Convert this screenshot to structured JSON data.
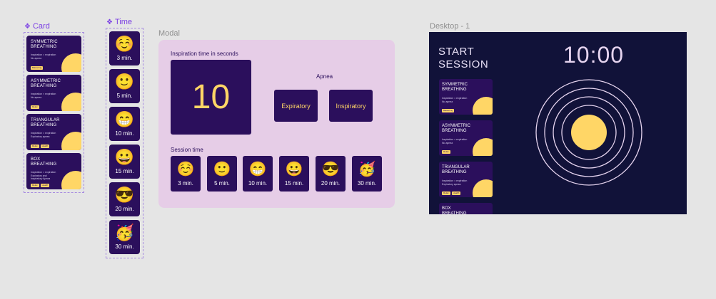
{
  "labels": {
    "card_component": "Card",
    "time_component": "Time",
    "modal_frame": "Modal",
    "desktop_frame": "Desktop - 1",
    "component_icon": "component-diamond-icon"
  },
  "cards": [
    {
      "title_1": "SYMMETRIC",
      "title_2": "BREATHING",
      "desc_1": "Inspiration = expiration",
      "desc_2": "No apnea",
      "tags": [
        "Balancing"
      ]
    },
    {
      "title_1": "ASYMMETRIC",
      "title_2": "BREATHING",
      "desc_1": "Inspiration < expiration",
      "desc_2": "No apnea",
      "tags": [
        "Relax"
      ]
    },
    {
      "title_1": "TRIANGULAR",
      "title_2": "BREATHING",
      "desc_1": "Inspiration = expiration",
      "desc_2": "Expiratory apnea",
      "tags": [
        "Relax",
        "Health"
      ]
    },
    {
      "title_1": "BOX",
      "title_2": "BREATHING",
      "desc_1": "Inspiration = expiration",
      "desc_2": "Expiratory and",
      "desc_3": "Inspiratory Apnea",
      "tags": [
        "Relax",
        "Health"
      ]
    }
  ],
  "times": [
    {
      "emoji": "☺️",
      "label": "3 min."
    },
    {
      "emoji": "🙂",
      "label": "5 min."
    },
    {
      "emoji": "😁",
      "label": "10 min."
    },
    {
      "emoji": "😀",
      "label": "15 min."
    },
    {
      "emoji": "😎",
      "label": "20 min."
    },
    {
      "emoji": "🥳",
      "label": "30 min."
    }
  ],
  "modal": {
    "inspiration_label": "Inspiration time in seconds",
    "inspiration_value": "10",
    "apnea_label": "Apnea",
    "apnea_options": [
      "Expiratory",
      "Inspiratory"
    ],
    "session_label": "Session time"
  },
  "desktop": {
    "start_line1": "START",
    "start_line2": "SESSION",
    "clock": "10:00"
  },
  "colors": {
    "card_bg": "#2b0f5c",
    "accent_yellow": "#ffd666",
    "modal_bg": "#e6cde7",
    "desktop_bg": "#111239",
    "ring": "#e6d4ef",
    "component_purple": "#7b3fe4"
  }
}
